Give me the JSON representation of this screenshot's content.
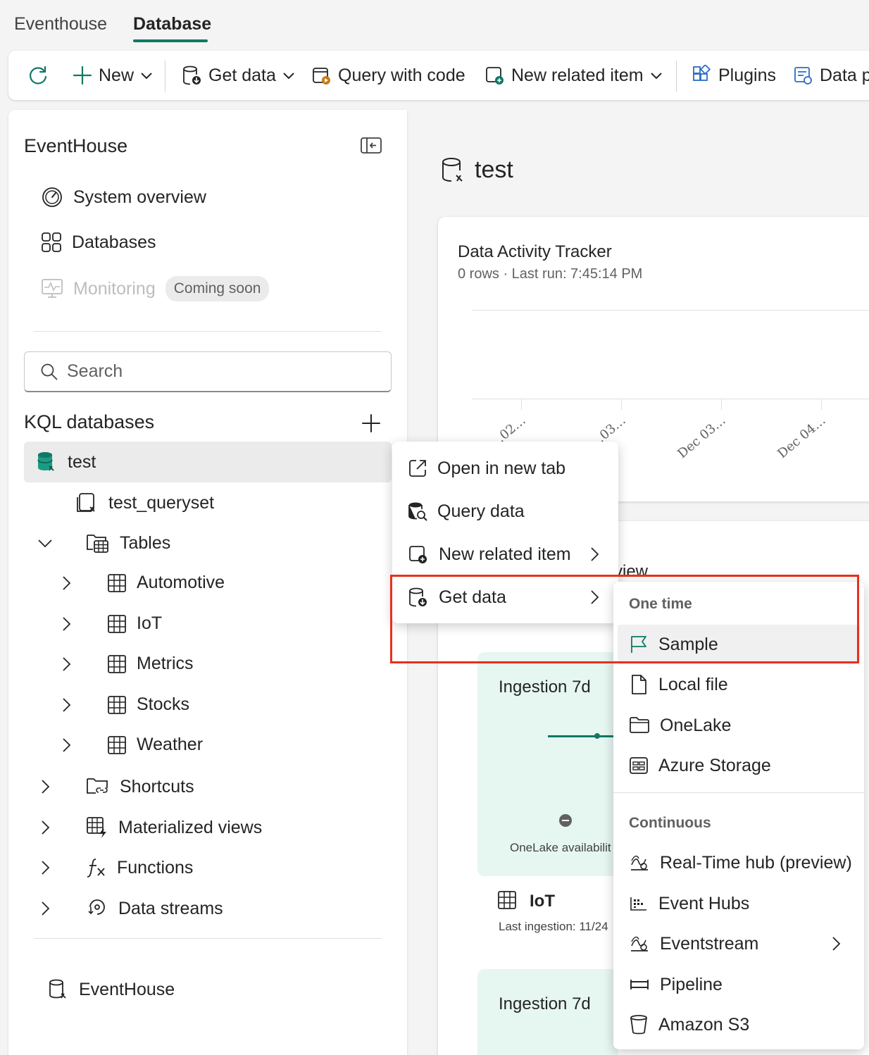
{
  "tabs": [
    {
      "label": "Eventhouse",
      "active": false
    },
    {
      "label": "Database",
      "active": true
    }
  ],
  "ribbon": {
    "new_label": "New",
    "get_data_label": "Get data",
    "query_with_code_label": "Query with code",
    "new_related_item_label": "New related item",
    "plugins_label": "Plugins",
    "data_label": "Data p"
  },
  "nav": {
    "title": "EventHouse",
    "items": [
      {
        "label": "System overview"
      },
      {
        "label": "Databases"
      },
      {
        "label": "Monitoring",
        "badge": "Coming soon"
      }
    ],
    "search_placeholder": "Search",
    "section_title": "KQL databases",
    "tree": {
      "database": "test",
      "queryset": "test_queryset",
      "tables_label": "Tables",
      "tables": [
        "Automotive",
        "IoT",
        "Metrics",
        "Stocks",
        "Weather"
      ],
      "folders": [
        "Shortcuts",
        "Materialized views",
        "Functions",
        "Data streams"
      ]
    },
    "footer_item": "EventHouse"
  },
  "main": {
    "title": "test",
    "tracker": {
      "title": "Data Activity Tracker",
      "subtitle": "0 rows · Last run: 7:45:14 PM",
      "ticks": [
        "…02…",
        "…03…",
        "Dec 03…",
        "Dec 04…"
      ]
    },
    "overview_partial": "view",
    "card1": {
      "title": "Ingestion 7d",
      "availability": "OneLake availabilit",
      "table_name": "IoT",
      "last_ingestion": "Last ingestion: 11/24"
    },
    "card2": {
      "title": "Ingestion 7d"
    }
  },
  "context_menu": {
    "items": [
      {
        "label": "Open in new tab"
      },
      {
        "label": "Query data"
      },
      {
        "label": "New related item"
      },
      {
        "label": "Get data"
      }
    ]
  },
  "submenu": {
    "one_time_header": "One time",
    "one_time": [
      "Sample",
      "Local file",
      "OneLake",
      "Azure Storage"
    ],
    "continuous_header": "Continuous",
    "continuous": [
      "Real-Time hub (preview)",
      "Event Hubs",
      "Eventstream",
      "Pipeline",
      "Amazon S3"
    ]
  },
  "colors": {
    "accent": "#117865",
    "highlight_border": "#e8301c",
    "card_green": "#e6f6f1"
  }
}
